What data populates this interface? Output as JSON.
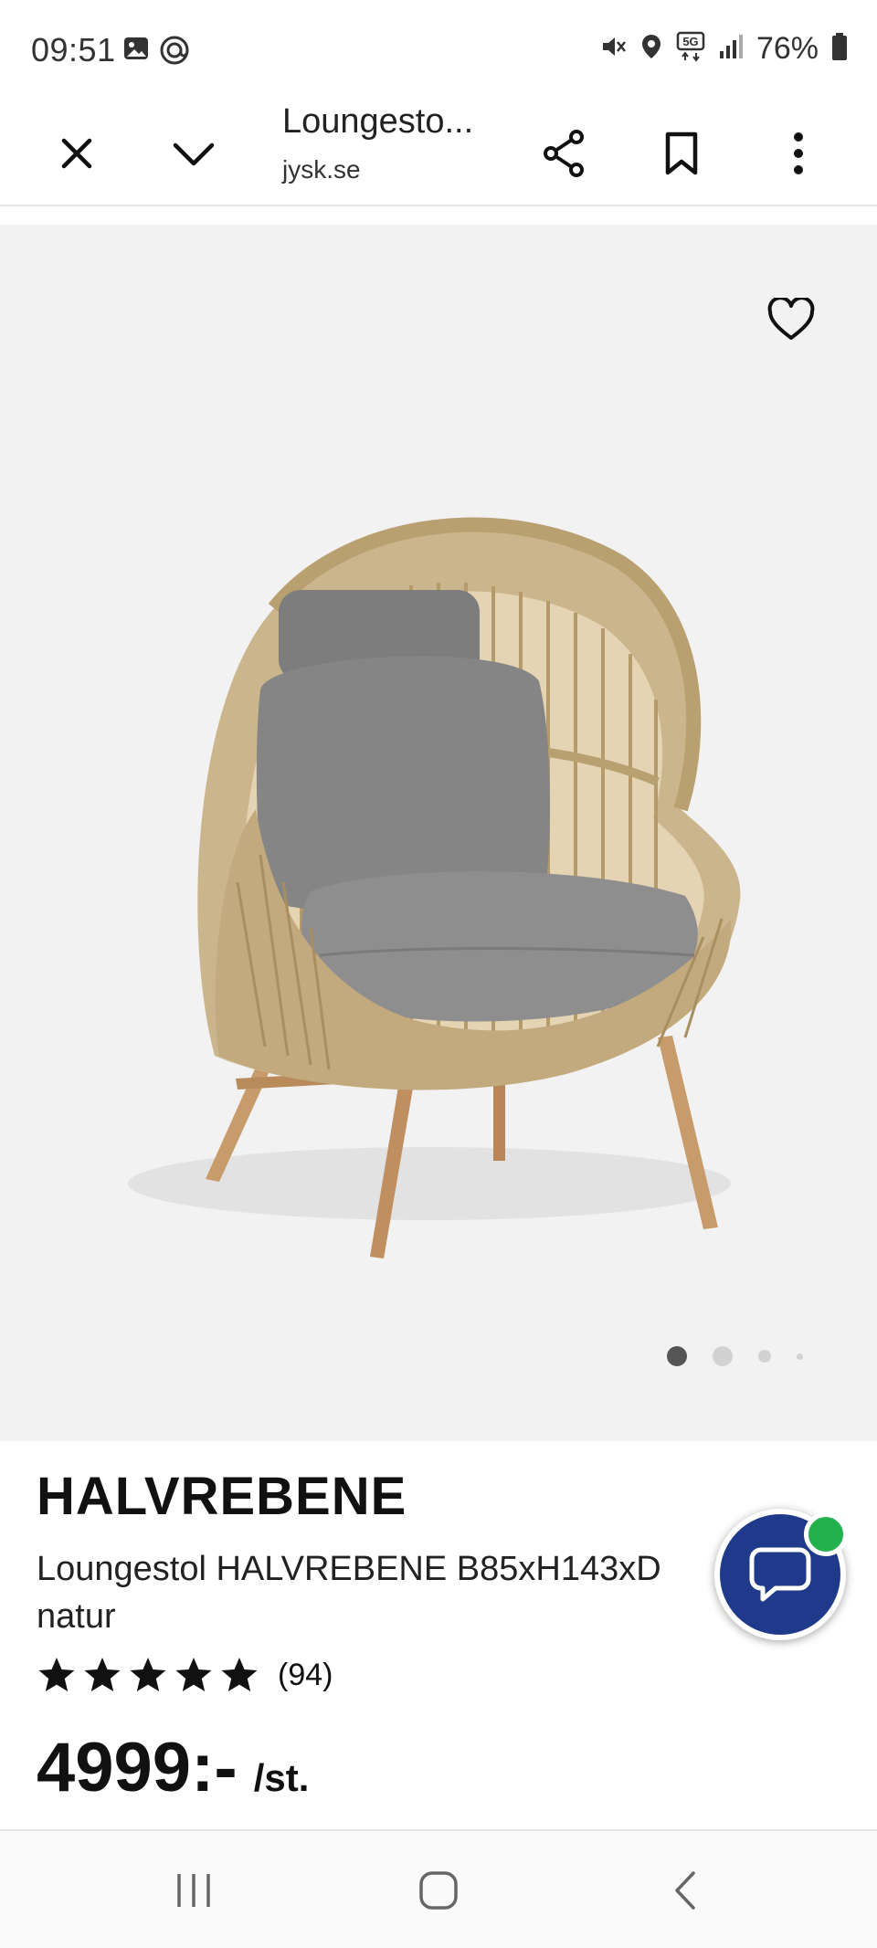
{
  "status_bar": {
    "time": "09:51",
    "battery": "76%",
    "icons": [
      "gallery-icon",
      "at-icon",
      "mute-icon",
      "location-icon",
      "5g-icon",
      "signal-icon",
      "battery-icon"
    ]
  },
  "toolbar": {
    "title": "Loungesto...",
    "domain": "jysk.se",
    "icons": [
      "close-icon",
      "chevron-down-icon",
      "share-icon",
      "bookmark-icon",
      "more-icon"
    ]
  },
  "product": {
    "brand": "HALVREBENE",
    "description": "Loungestol HALVREBENE B85xH143xD natur",
    "rating_count": "(94)",
    "stars": 5,
    "price": "4999:-",
    "unit": "/st."
  },
  "gallery": {
    "active_index": 0,
    "dot_count": 4
  },
  "colors": {
    "chat_bg": "#1f3a8a",
    "chat_badge": "#22b14c",
    "hero_bg": "#f2f2f2"
  }
}
